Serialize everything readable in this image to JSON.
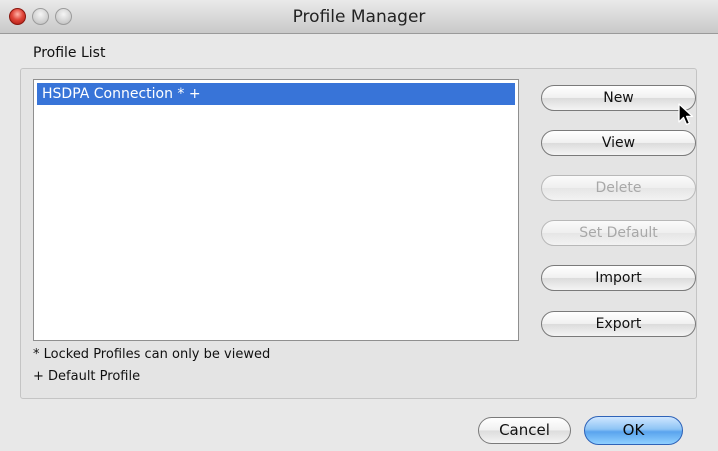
{
  "window": {
    "title": "Profile Manager"
  },
  "profile_list": {
    "group_label": "Profile List",
    "items": [
      {
        "label": "HSDPA Connection * +",
        "selected": true
      }
    ],
    "notes": {
      "locked": "* Locked Profiles can only be viewed",
      "default": "+ Default Profile"
    }
  },
  "side_buttons": {
    "new": {
      "label": "New",
      "enabled": true
    },
    "view": {
      "label": "View",
      "enabled": true
    },
    "delete": {
      "label": "Delete",
      "enabled": false
    },
    "set_default": {
      "label": "Set Default",
      "enabled": false
    },
    "import": {
      "label": "Import",
      "enabled": true
    },
    "export": {
      "label": "Export",
      "enabled": true
    }
  },
  "footer": {
    "cancel_label": "Cancel",
    "ok_label": "OK"
  },
  "colors": {
    "selection": "#3874d8",
    "ok_button": "#5aa4ee",
    "close_button": "#e0463a"
  },
  "icons": {
    "close": "close-icon",
    "minimize": "minimize-icon",
    "zoom": "zoom-icon",
    "cursor": "mouse-pointer-icon"
  }
}
